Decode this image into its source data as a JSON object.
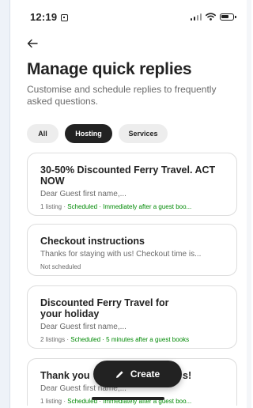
{
  "status_bar": {
    "time": "12:19"
  },
  "page": {
    "title": "Manage quick replies",
    "subtitle": "Customise and schedule replies to frequently asked questions."
  },
  "tabs": [
    {
      "label": "All",
      "selected": false
    },
    {
      "label": "Hosting",
      "selected": true
    },
    {
      "label": "Services",
      "selected": false
    }
  ],
  "replies": [
    {
      "title": "30-50% Discounted Ferry Travel. ACT NOW",
      "preview": "Dear Guest first name,...",
      "listings": "1 listing",
      "separator": " · ",
      "status": "Scheduled",
      "timing": " · Immediately after a guest boo..."
    },
    {
      "title": "Checkout instructions",
      "preview": "Thanks for staying with us! Checkout time is...",
      "status": "Not scheduled"
    },
    {
      "title": "Discounted Ferry Travel for your holiday",
      "preview": "Dear Guest first name,...",
      "listings": "2 listings",
      "separator": " · ",
      "status": "Scheduled",
      "timing": " · 5 minutes after a guest books"
    },
    {
      "title_start": "Thank you",
      "title_end": "s!",
      "preview": "Dear Guest first name,...",
      "listings": "1 listing",
      "separator": " · ",
      "status": "Scheduled",
      "timing": " · Immediately after a guest boo..."
    }
  ],
  "create_button": {
    "label": "Create",
    "icon": "pencil-icon"
  },
  "colors": {
    "accent_dark": "#222222",
    "scheduled_green": "#008a05",
    "muted_text": "#6a6a6a"
  }
}
